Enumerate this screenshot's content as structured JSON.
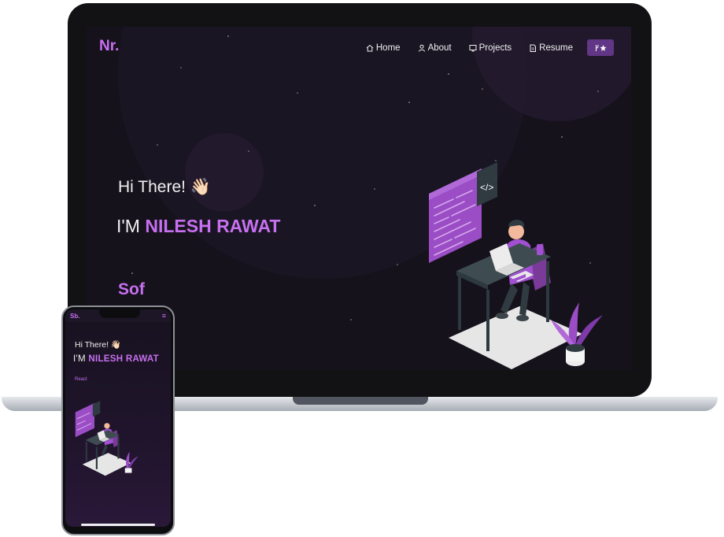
{
  "laptop": {
    "logo": "Nr.",
    "nav": [
      {
        "label": "Home",
        "icon": "home-icon"
      },
      {
        "label": "About",
        "icon": "user-icon"
      },
      {
        "label": "Projects",
        "icon": "projects-icon"
      },
      {
        "label": "Resume",
        "icon": "document-icon"
      }
    ],
    "nav_button": {
      "icons": [
        "fork-icon",
        "star-icon"
      ]
    },
    "hero": {
      "greeting": "Hi There!",
      "greeting_emoji": "👋🏻",
      "name_prefix": "I'M",
      "name": "NILESH RAWAT",
      "typed_text": "Sof"
    }
  },
  "phone": {
    "logo": "Sb.",
    "menu_icon": "hamburger-icon",
    "greeting": "Hi There!",
    "greeting_emoji": "👋🏻",
    "name_prefix": "I'M",
    "name": "NILESH RAWAT",
    "typed_text": "React"
  },
  "colors": {
    "accent": "#c770f0",
    "background": "#16121c",
    "button": "#623686",
    "text": "#f0f0f0"
  }
}
